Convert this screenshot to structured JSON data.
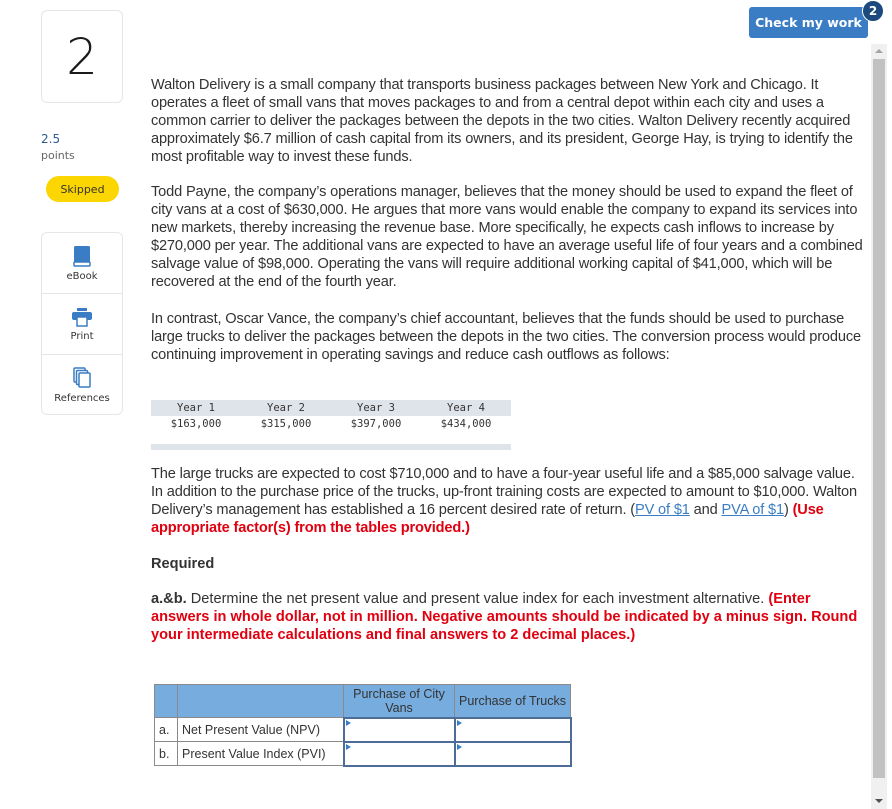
{
  "sidebar": {
    "question_number": "2",
    "points_value": "2.5",
    "points_label": "points",
    "status": "Skipped",
    "status_color": "#fcd600",
    "tools": [
      {
        "label": "eBook",
        "icon": "book-icon"
      },
      {
        "label": "Print",
        "icon": "printer-icon"
      },
      {
        "label": "References",
        "icon": "references-icon"
      }
    ]
  },
  "header": {
    "check_button": "Check my work",
    "check_badge": "2",
    "accent_color": "#3b7dc4"
  },
  "problem": {
    "p1": "Walton Delivery is a small company that transports business packages between New York and Chicago. It operates a fleet of small vans that moves packages to and from a central depot within each city and uses a common carrier to deliver the packages between the depots in the two cities. Walton Delivery recently acquired approximately $6.7 million of cash capital from its owners, and its president, George Hay, is trying to identify the most profitable way to invest these funds.",
    "p2": "Todd Payne, the company’s operations manager, believes that the money should be used to expand the fleet of city vans at a cost of $630,000. He argues that more vans would enable the company to expand its services into new markets, thereby increasing the revenue base. More specifically, he expects cash inflows to increase by $270,000 per year. The additional vans are expected to have an average useful life of four years and a combined salvage value of $98,000. Operating the vans will require additional working capital of $41,000, which will be recovered at the end of the fourth year.",
    "p3": "In contrast, Oscar Vance, the company’s chief accountant, believes that the funds should be used to purchase large trucks to deliver the packages between the depots in the two cities. The conversion process would produce continuing improvement in operating savings and reduce cash outflows as follows:",
    "savings_table": {
      "headers": [
        "Year 1",
        "Year 2",
        "Year 3",
        "Year 4"
      ],
      "values": [
        "$163,000",
        "$315,000",
        "$397,000",
        "$434,000"
      ]
    },
    "p4": "The large trucks are expected to cost $710,000 and to have a four-year useful life and a $85,000 salvage value. In addition to the purchase price of the trucks, up-front training costs are expected to amount to $10,000. Walton Delivery’s management has established a 16 percent desired rate of return. (",
    "link_pv": "PV of $1",
    "link_and": " and ",
    "link_pva": "PVA of $1",
    "p4_close": ") ",
    "p4_instruction": "(Use appropriate factor(s) from the tables provided.)"
  },
  "required": {
    "heading": "Required",
    "label": "a.&b.",
    "text": " Determine the net present value and present value index for each investment alternative. ",
    "instruction": "(Enter answers in whole dollar, not in million. Negative amounts should be indicated by a minus sign. Round your intermediate calculations and final answers to 2 decimal places.)"
  },
  "answer_table": {
    "columns": [
      "Purchase of City Vans",
      "Purchase of Trucks"
    ],
    "rows": [
      {
        "letter": "a.",
        "label": "Net Present Value (NPV)",
        "values": [
          "",
          ""
        ]
      },
      {
        "letter": "b.",
        "label": "Present Value Index (PVI)",
        "values": [
          "",
          ""
        ]
      }
    ],
    "header_color": "#77acde"
  }
}
